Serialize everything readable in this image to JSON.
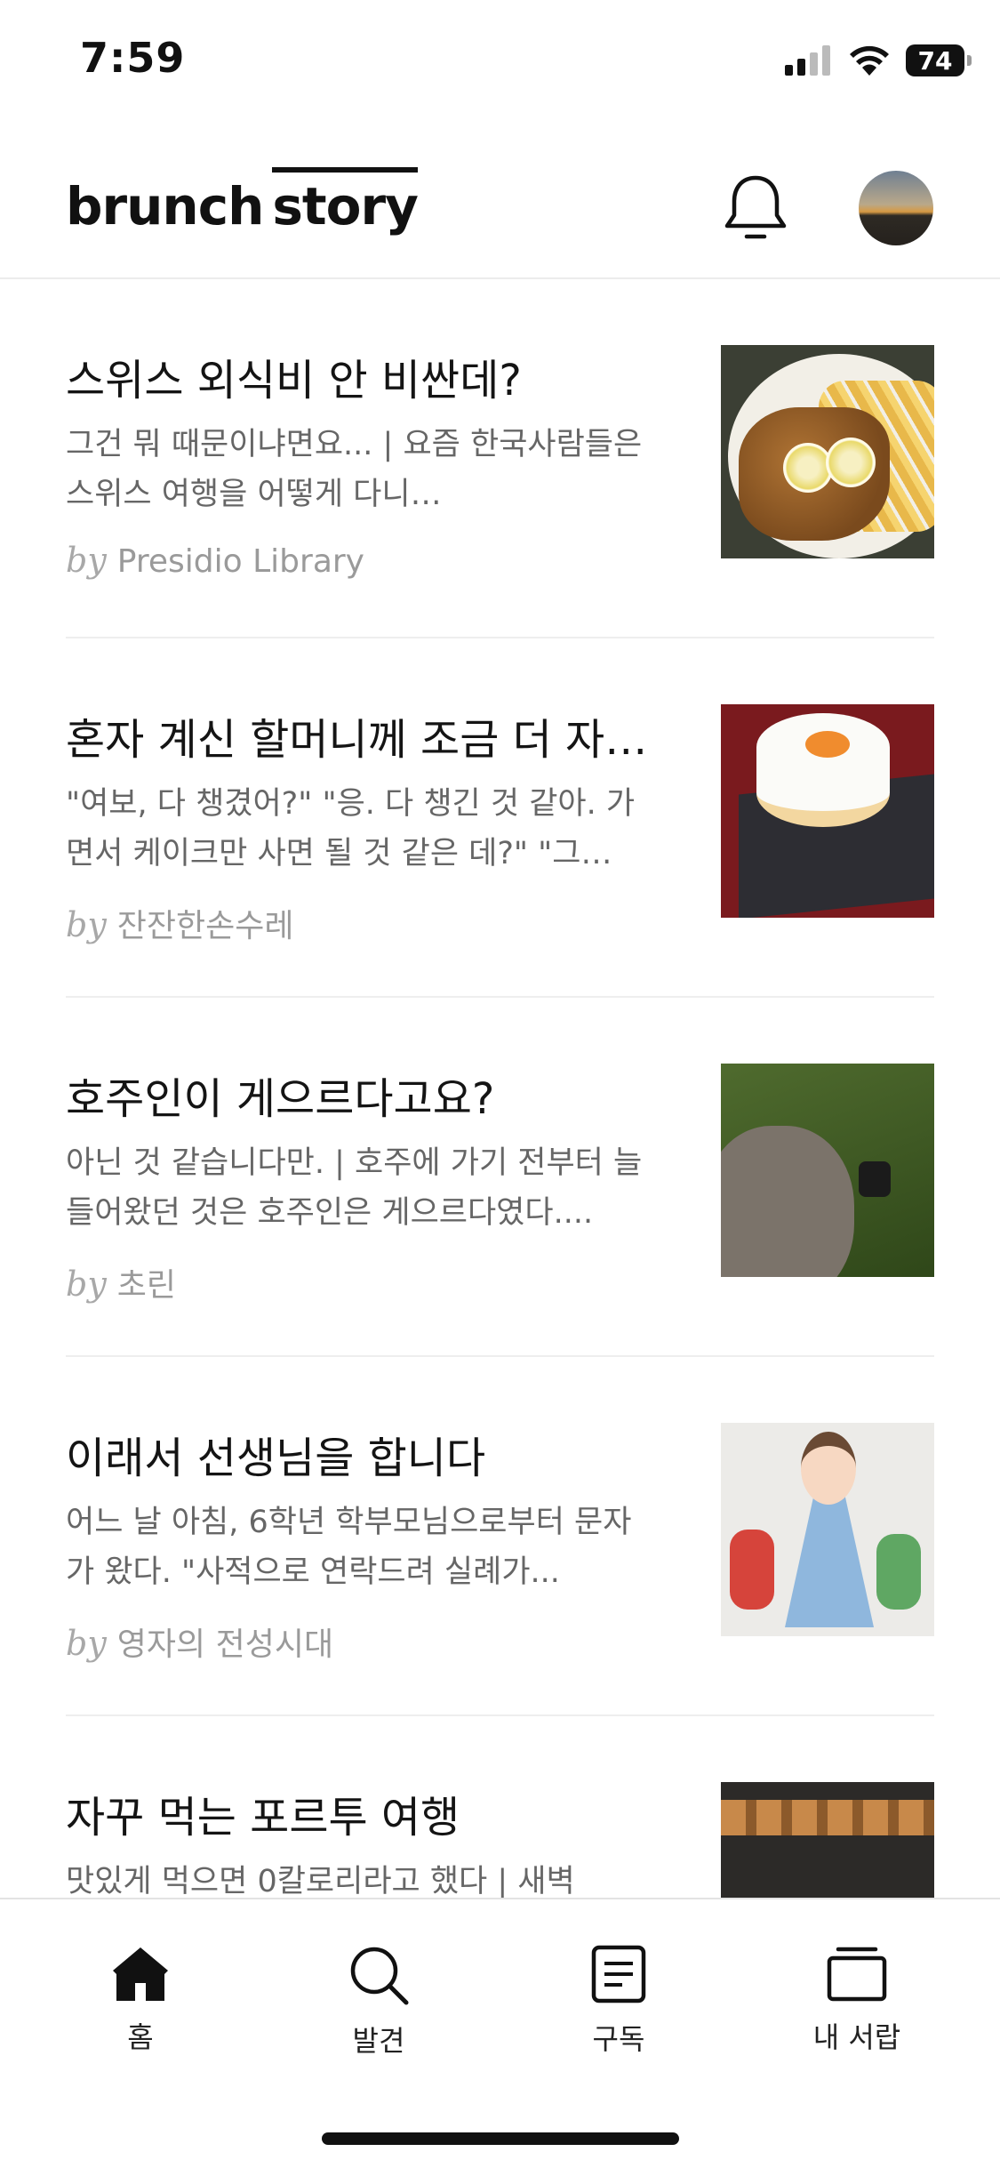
{
  "status_bar": {
    "time": "7:59",
    "battery": "74",
    "icons": [
      "signal-icon",
      "wifi-icon",
      "battery-icon"
    ]
  },
  "header": {
    "logo_part1": "brunch",
    "logo_part2": "story",
    "notification_icon": "bell-icon",
    "avatar": "profile-avatar"
  },
  "articles": [
    {
      "title": "스위스 외식비 안 비싼데?",
      "excerpt": "그건 뭐 때문이냐면요... | 요즘 한국사람들은 스위스 여행을 어떻게 다니…",
      "by": "by",
      "author": "Presidio Library",
      "thumbnail": "schnitzel-fries-photo"
    },
    {
      "title": "혼자 계신 할머니께 조금 더 자…",
      "excerpt": "\"여보, 다 챙겼어?\" \"응. 다 챙긴 것 같아. 가면서 케이크만 사면 될 것 같은 데?\" \"그…",
      "by": "by",
      "author": "잔잔한손수레",
      "thumbnail": "birthday-cake-photo"
    },
    {
      "title": "호주인이 게으르다고요?",
      "excerpt": "아닌 것 같습니다만. | 호주에 가기 전부터 늘 들어왔던 것은 호주인은 게으르다였다....",
      "by": "by",
      "author": "초린",
      "thumbnail": "grass-picnic-photo"
    },
    {
      "title": "이래서 선생님을 합니다",
      "excerpt": "어느 날 아침, 6학년 학부모님으로부터 문자가 왔다. \"사적으로 연락드려 실례가...",
      "by": "by",
      "author": "영자의 전성시대",
      "thumbnail": "teacher-children-illustration"
    },
    {
      "title": "자꾸 먹는 포르투 여행",
      "excerpt": "맛있게 먹으면 0칼로리라고 했다 | 새벽",
      "by": "",
      "author": "",
      "thumbnail": "bakery-display-photo"
    }
  ],
  "tab_bar": {
    "tabs": [
      {
        "label": "홈",
        "icon": "home-icon",
        "active": true
      },
      {
        "label": "발견",
        "icon": "search-icon",
        "active": false
      },
      {
        "label": "구독",
        "icon": "document-icon",
        "active": false
      },
      {
        "label": "내 서랍",
        "icon": "drawer-icon",
        "active": false
      }
    ]
  }
}
